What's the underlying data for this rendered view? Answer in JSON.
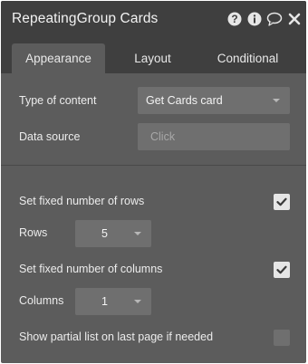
{
  "header": {
    "title": "RepeatingGroup Cards",
    "icons": [
      "help-icon",
      "info-icon",
      "comment-icon",
      "close-icon"
    ]
  },
  "tabs": [
    {
      "label": "Appearance",
      "active": true
    },
    {
      "label": "Layout",
      "active": false
    },
    {
      "label": "Conditional",
      "active": false
    }
  ],
  "content": {
    "type_of_content": {
      "label": "Type of content",
      "value": "Get Cards card"
    },
    "data_source": {
      "label": "Data source",
      "placeholder": "Click"
    },
    "fixed_rows": {
      "label": "Set fixed number of rows",
      "checked": true
    },
    "rows": {
      "label": "Rows",
      "value": "5"
    },
    "fixed_columns": {
      "label": "Set fixed number of columns",
      "checked": true
    },
    "columns": {
      "label": "Columns",
      "value": "1"
    },
    "partial_list": {
      "label": "Show partial list on last page if needed",
      "checked": false
    }
  },
  "colors": {
    "panel_bg": "#5c5c5c",
    "header_bg": "#3f3f3f",
    "field_bg": "#6f6f6f"
  }
}
